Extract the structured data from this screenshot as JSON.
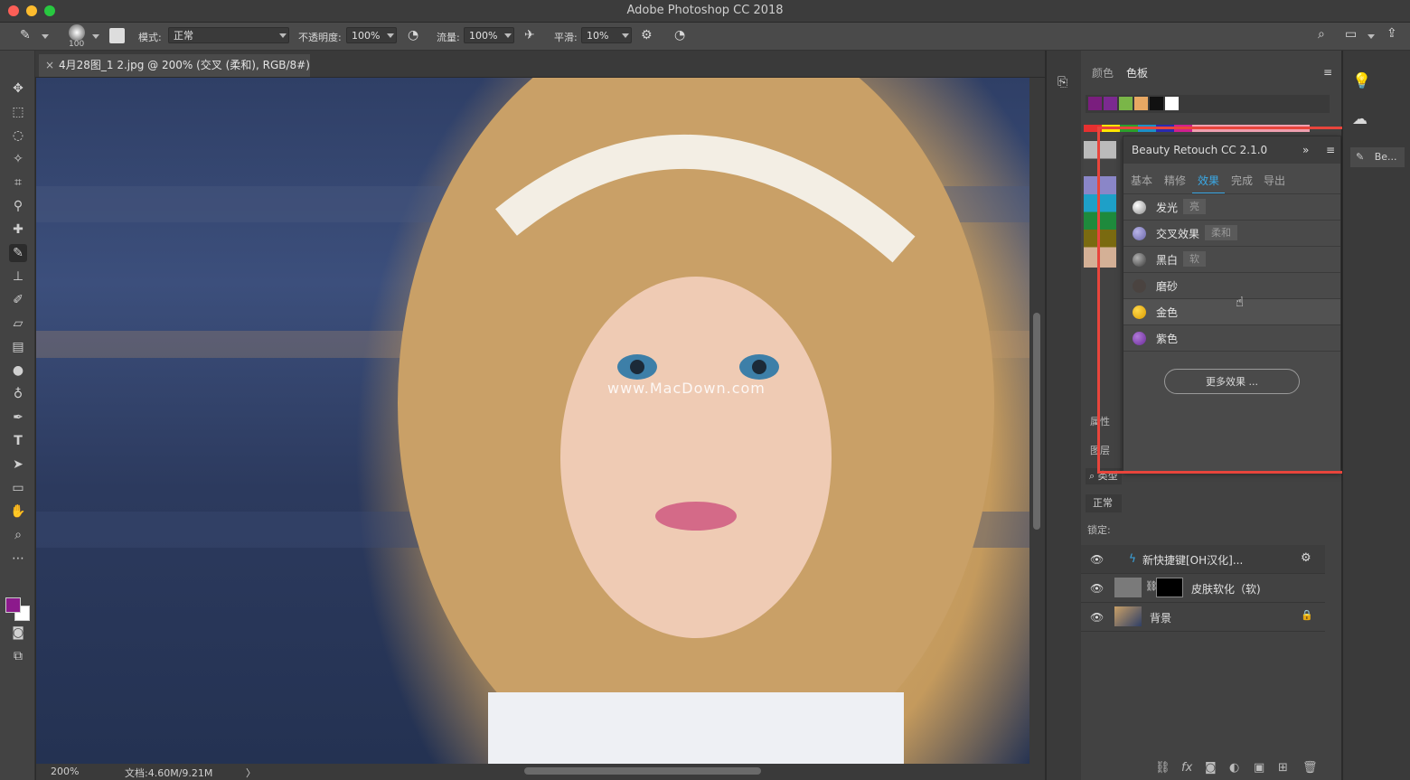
{
  "app": {
    "title": "Adobe Photoshop CC 2018"
  },
  "options_bar": {
    "brush_size": "100",
    "mode_label": "模式:",
    "mode_value": "正常",
    "opacity_label": "不透明度:",
    "opacity_value": "100%",
    "flow_label": "流量:",
    "flow_value": "100%",
    "smoothing_label": "平滑:",
    "smoothing_value": "10%"
  },
  "document": {
    "tab_title": "4月28图_1 2.jpg @ 200% (交叉 (柔和), RGB/8#) *",
    "close_glyph": "×",
    "zoom": "200%",
    "doc_size": "文档:4.60M/9.21M",
    "status_arrow": "〉",
    "watermark": "www.MacDown.com"
  },
  "swatches_panel": {
    "tabs": [
      "颜色",
      "色板"
    ],
    "active_tab": "色板",
    "recent_colors": [
      "#7a1e7e",
      "#7b2a90",
      "#7ab648",
      "#e8a863",
      "#111111",
      "#ffffff"
    ],
    "grid_colors": [
      "#e63030",
      "#ffe600",
      "#2ca02c",
      "#1e90c8",
      "#2b2bb0",
      "#d02090",
      "#e06070",
      "#f0a0b0",
      "#f0a0b0",
      "#f0a0b0",
      "#f0a0b0",
      "#f0a0b0",
      "#f0a0b0",
      "#f0a0b0"
    ]
  },
  "plugin": {
    "title": "Beauty Retouch CC 2.1.0",
    "tabs": [
      "基本",
      "精修",
      "效果",
      "完成",
      "导出"
    ],
    "active_tab": "效果",
    "effects": [
      {
        "name": "发光",
        "tag": "亮",
        "color": "#d8d8d8",
        "highlight": false
      },
      {
        "name": "交叉效果",
        "tag": "柔和",
        "color": "#8a86c8",
        "highlight": false
      },
      {
        "name": "黑白",
        "tag": "软",
        "color": "#7a7a7a",
        "highlight": false
      },
      {
        "name": "磨砂",
        "tag": "",
        "color": "#4a4340",
        "highlight": false
      },
      {
        "name": "金色",
        "tag": "",
        "color": "#f0b400",
        "highlight": true
      },
      {
        "name": "紫色",
        "tag": "",
        "color": "#8a4ab8",
        "highlight": false
      }
    ],
    "more_button": "更多效果 ..."
  },
  "layers_panel": {
    "properties_tab": "属性",
    "layers_tab": "图层",
    "search_kind": "类型",
    "blend_mode": "正常",
    "lock_label": "锁定:",
    "layers": [
      {
        "name": "新快捷键[OH汉化]...",
        "locked": false
      },
      {
        "name": "皮肤软化（软)",
        "locked": false
      },
      {
        "name": "背景",
        "locked": true
      }
    ]
  },
  "right_dock": {
    "beauty_button": "Be..."
  },
  "colors": {
    "foreground": "#8c1a8c",
    "background": "#ffffff",
    "highlight_box": "#e8453c",
    "accent": "#3aa9e6"
  }
}
